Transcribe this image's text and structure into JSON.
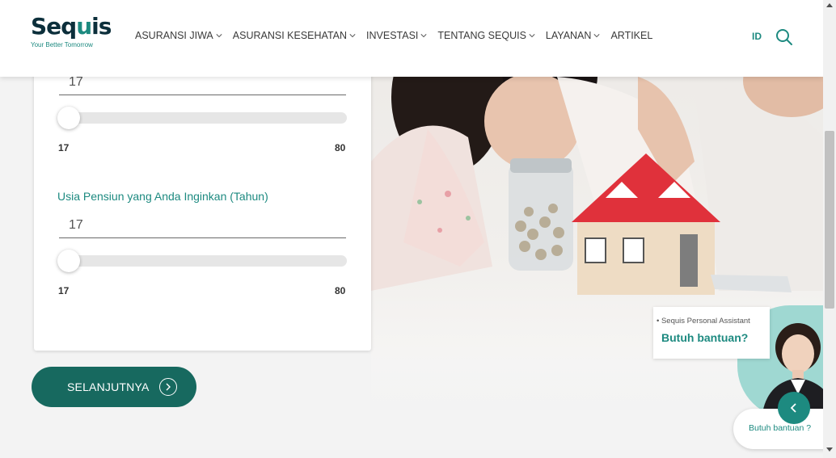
{
  "header": {
    "logo_text_pre": "Seq",
    "logo_text_u": "u",
    "logo_text_post": "is",
    "logo_tagline": "Your Better Tomorrow",
    "nav": [
      {
        "label": "ASURANSI JIWA",
        "dropdown": true
      },
      {
        "label": "ASURANSI KESEHATAN",
        "dropdown": true
      },
      {
        "label": "INVESTASI",
        "dropdown": true
      },
      {
        "label": "TENTANG SEQUIS",
        "dropdown": true
      },
      {
        "label": "LAYANAN",
        "dropdown": true
      },
      {
        "label": "ARTIKEL",
        "dropdown": false
      }
    ],
    "language": "ID",
    "search_icon": "search-icon"
  },
  "form": {
    "current_age": {
      "value": "17",
      "slider_value": 17,
      "min_label": "17",
      "max_label": "80"
    },
    "retirement_age": {
      "label": "Usia Pensiun yang Anda Inginkan (Tahun)",
      "value": "17",
      "slider_value": 17,
      "min_label": "17",
      "max_label": "80"
    },
    "next_button": "SELANJUTNYA"
  },
  "assistant": {
    "title": "Sequis Personal Assistant",
    "heading": "Butuh bantuan?",
    "pill_label": "Butuh bantuan ?"
  },
  "colors": {
    "brand_teal": "#1d8a80",
    "button_dark_teal": "#17695f",
    "logo_dark": "#0c2f3b"
  }
}
